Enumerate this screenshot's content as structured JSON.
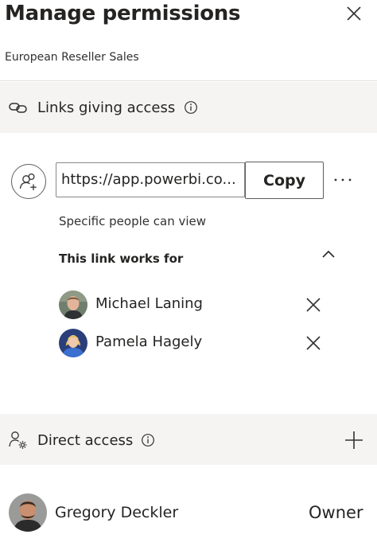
{
  "panel": {
    "title": "Manage permissions",
    "subtitle": "European Reseller Sales"
  },
  "links_section": {
    "label": "Links giving access",
    "link_url": "https://app.powerbi.co...",
    "copy_label": "Copy",
    "link_description": "Specific people can view",
    "works_for_label": "This link works for",
    "people": [
      {
        "name": "Michael Laning"
      },
      {
        "name": "Pamela Hagely"
      }
    ]
  },
  "direct_section": {
    "label": "Direct access",
    "users": [
      {
        "name": "Gregory Deckler",
        "role": "Owner"
      }
    ]
  }
}
